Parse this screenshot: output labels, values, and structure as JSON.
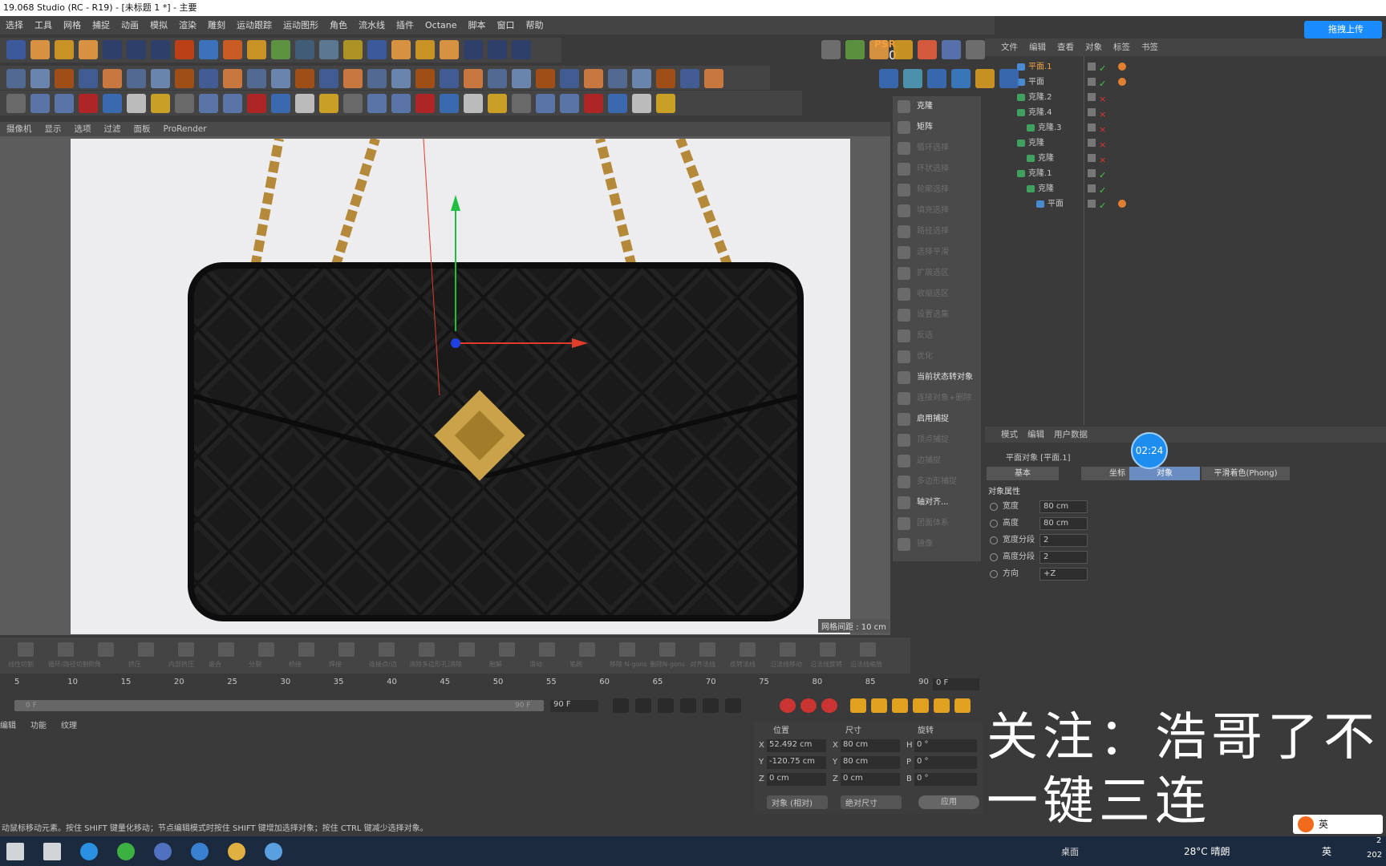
{
  "window": {
    "title": "19.068 Studio (RC - R19) - [未标题 1 *] - 主要",
    "upload_button": "拖拽上传"
  },
  "menu": [
    "选择",
    "工具",
    "网格",
    "捕捉",
    "动画",
    "模拟",
    "渲染",
    "雕刻",
    "运动跟踪",
    "运动图形",
    "角色",
    "流水线",
    "插件",
    "Octane",
    "脚本",
    "窗口",
    "帮助"
  ],
  "psr": {
    "label": "PSR",
    "value": "0"
  },
  "viewport": {
    "menu": [
      "摄像机",
      "显示",
      "选项",
      "过滤",
      "面板",
      "ProRender"
    ],
    "grid_label": "网格间距 : 10 cm"
  },
  "right_tools": [
    {
      "label": "克隆",
      "enabled": true
    },
    {
      "label": "矩阵",
      "enabled": true
    },
    {
      "label": "循环选择",
      "enabled": false
    },
    {
      "label": "环状选择",
      "enabled": false
    },
    {
      "label": "轮廓选择",
      "enabled": false
    },
    {
      "label": "填充选择",
      "enabled": false
    },
    {
      "label": "路径选择",
      "enabled": false
    },
    {
      "label": "选择平滑",
      "enabled": false
    },
    {
      "label": "扩展选区",
      "enabled": false
    },
    {
      "label": "收缩选区",
      "enabled": false
    },
    {
      "label": "设置选集",
      "enabled": false
    },
    {
      "label": "反选",
      "enabled": false
    },
    {
      "label": "优化",
      "enabled": false
    },
    {
      "label": "当前状态转对象",
      "enabled": true
    },
    {
      "label": "连接对象+删除",
      "enabled": false
    },
    {
      "label": "启用捕捉",
      "enabled": true
    },
    {
      "label": "顶点捕捉",
      "enabled": false
    },
    {
      "label": "边捕捉",
      "enabled": false
    },
    {
      "label": "多边形捕捉",
      "enabled": false
    },
    {
      "label": "轴对齐...",
      "enabled": true
    },
    {
      "label": "团面体系",
      "enabled": false
    },
    {
      "label": "镜像",
      "enabled": false
    }
  ],
  "object_manager": {
    "menu": [
      "文件",
      "编辑",
      "查看",
      "对象",
      "标签",
      "书签"
    ],
    "rows": [
      {
        "name": "平面.1",
        "depth": 0,
        "selected": true,
        "tags": true
      },
      {
        "name": "平面",
        "depth": 0,
        "selected": false,
        "tags": true
      },
      {
        "name": "克隆.2",
        "depth": 0,
        "selected": false,
        "tags": false
      },
      {
        "name": "克隆.4",
        "depth": 0,
        "selected": false,
        "tags": false
      },
      {
        "name": "克隆.3",
        "depth": 1,
        "selected": false,
        "tags": false
      },
      {
        "name": "克隆",
        "depth": 0,
        "selected": false,
        "tags": false
      },
      {
        "name": "克隆",
        "depth": 1,
        "selected": false,
        "tags": false
      },
      {
        "name": "克隆.1",
        "depth": 0,
        "selected": false,
        "tags": false
      },
      {
        "name": "克隆",
        "depth": 1,
        "selected": false,
        "tags": false
      },
      {
        "name": "平面",
        "depth": 2,
        "selected": false,
        "tags": true
      }
    ]
  },
  "attributes": {
    "menu": [
      "模式",
      "编辑",
      "用户数据"
    ],
    "object_title": "平面对象 [平面.1]",
    "tabs": [
      "基本",
      "坐标",
      "对象",
      "平滑着色(Phong)"
    ],
    "active_tab": "对象",
    "timer": "02:24",
    "section": "对象属性",
    "props": [
      {
        "label": "宽度",
        "value": "80 cm"
      },
      {
        "label": "高度",
        "value": "80 cm"
      },
      {
        "label": "宽度分段",
        "value": "2"
      },
      {
        "label": "高度分段",
        "value": "2"
      },
      {
        "label": "方向",
        "value": "+Z"
      }
    ]
  },
  "bottom_tools": [
    "线性切割",
    "循环/路径切割",
    "倒角",
    "挤压",
    "内部挤压",
    "嵌合",
    "分裂",
    "桥接",
    "焊接",
    "连接点/边",
    "消除多边形孔洞",
    "消除",
    "融解",
    "滑动",
    "笔刷",
    "移除 N-gons",
    "删除N-gons",
    "对齐法线",
    "反转法线",
    "沿法线移动",
    "沿法线旋转",
    "沿法线缩放"
  ],
  "timeline": {
    "ticks": [
      "5",
      "10",
      "15",
      "20",
      "25",
      "30",
      "35",
      "40",
      "45",
      "50",
      "55",
      "60",
      "65",
      "70",
      "75",
      "80",
      "85",
      "90"
    ],
    "current_frame": "0 F",
    "start": "0 F",
    "end": "90 F",
    "end2": "90 F",
    "menu": [
      "编辑",
      "功能",
      "纹理"
    ]
  },
  "coordinates": {
    "headers": [
      "位置",
      "尺寸",
      "旋转"
    ],
    "rows": [
      {
        "axis": "X",
        "pos": "52.492 cm",
        "size_axis": "X",
        "size": "80 cm",
        "rot_axis": "H",
        "rot": "0 °"
      },
      {
        "axis": "Y",
        "pos": "-120.75 cm",
        "size_axis": "Y",
        "size": "80 cm",
        "rot_axis": "P",
        "rot": "0 °"
      },
      {
        "axis": "Z",
        "pos": "0 cm",
        "size_axis": "Z",
        "size": "0 cm",
        "rot_axis": "B",
        "rot": "0 °"
      }
    ],
    "mode": "对象 (相对)",
    "size_mode": "绝对尺寸",
    "apply": "应用"
  },
  "status": "动鼠标移动元素。按住 SHIFT 键量化移动；节点编辑模式时按住 SHIFT 键增加选择对象；按住 CTRL 键减少选择对象。",
  "overlay": {
    "line1": "关注：浩哥了不",
    "line2": "一键三连"
  },
  "taskbar": {
    "desktop": "桌面",
    "weather": "28°C 晴朗",
    "lang": "英",
    "clock_short": "2",
    "clock_year": "202",
    "ime": "英"
  },
  "colors": {
    "accent": "#4a7fc0",
    "selected": "#f0a040",
    "ui_bg": "#3a3a3a",
    "panel": "#444444"
  }
}
